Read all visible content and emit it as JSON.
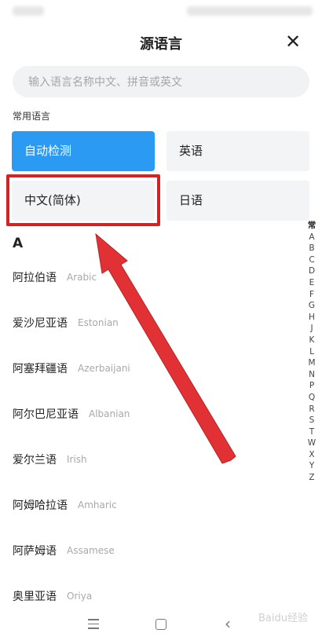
{
  "header": {
    "title": "源语言",
    "close_icon": "close-icon"
  },
  "search": {
    "placeholder": "输入语言名称中文、拼音或英文"
  },
  "common": {
    "section_label": "常用语言",
    "tiles": [
      {
        "label": "自动检测",
        "selected": true
      },
      {
        "label": "英语",
        "selected": false
      },
      {
        "label": "中文(简体)",
        "selected": false
      },
      {
        "label": "日语",
        "selected": false
      }
    ],
    "highlighted": "中文(简体)"
  },
  "list": {
    "section_letter": "A",
    "items": [
      {
        "zh": "阿拉伯语",
        "en": "Arabic"
      },
      {
        "zh": "爱沙尼亚语",
        "en": "Estonian"
      },
      {
        "zh": "阿塞拜疆语",
        "en": "Azerbaijani"
      },
      {
        "zh": "阿尔巴尼亚语",
        "en": "Albanian"
      },
      {
        "zh": "爱尔兰语",
        "en": "Irish"
      },
      {
        "zh": "阿姆哈拉语",
        "en": "Amharic"
      },
      {
        "zh": "阿萨姆语",
        "en": "Assamese"
      },
      {
        "zh": "奥里亚语",
        "en": "Oriya"
      }
    ]
  },
  "index_bar": [
    "常",
    "A",
    "B",
    "C",
    "D",
    "E",
    "F",
    "G",
    "H",
    "J",
    "K",
    "L",
    "M",
    "N",
    "P",
    "Q",
    "R",
    "S",
    "T",
    "W",
    "X",
    "Y",
    "Z"
  ],
  "colors": {
    "accent": "#2b9af3",
    "highlight": "#d42323",
    "arrow": "#e0262a"
  },
  "navbar": {
    "icons": [
      "menu-icon",
      "home-icon",
      "back-icon"
    ]
  },
  "watermark": "Baidu经验"
}
